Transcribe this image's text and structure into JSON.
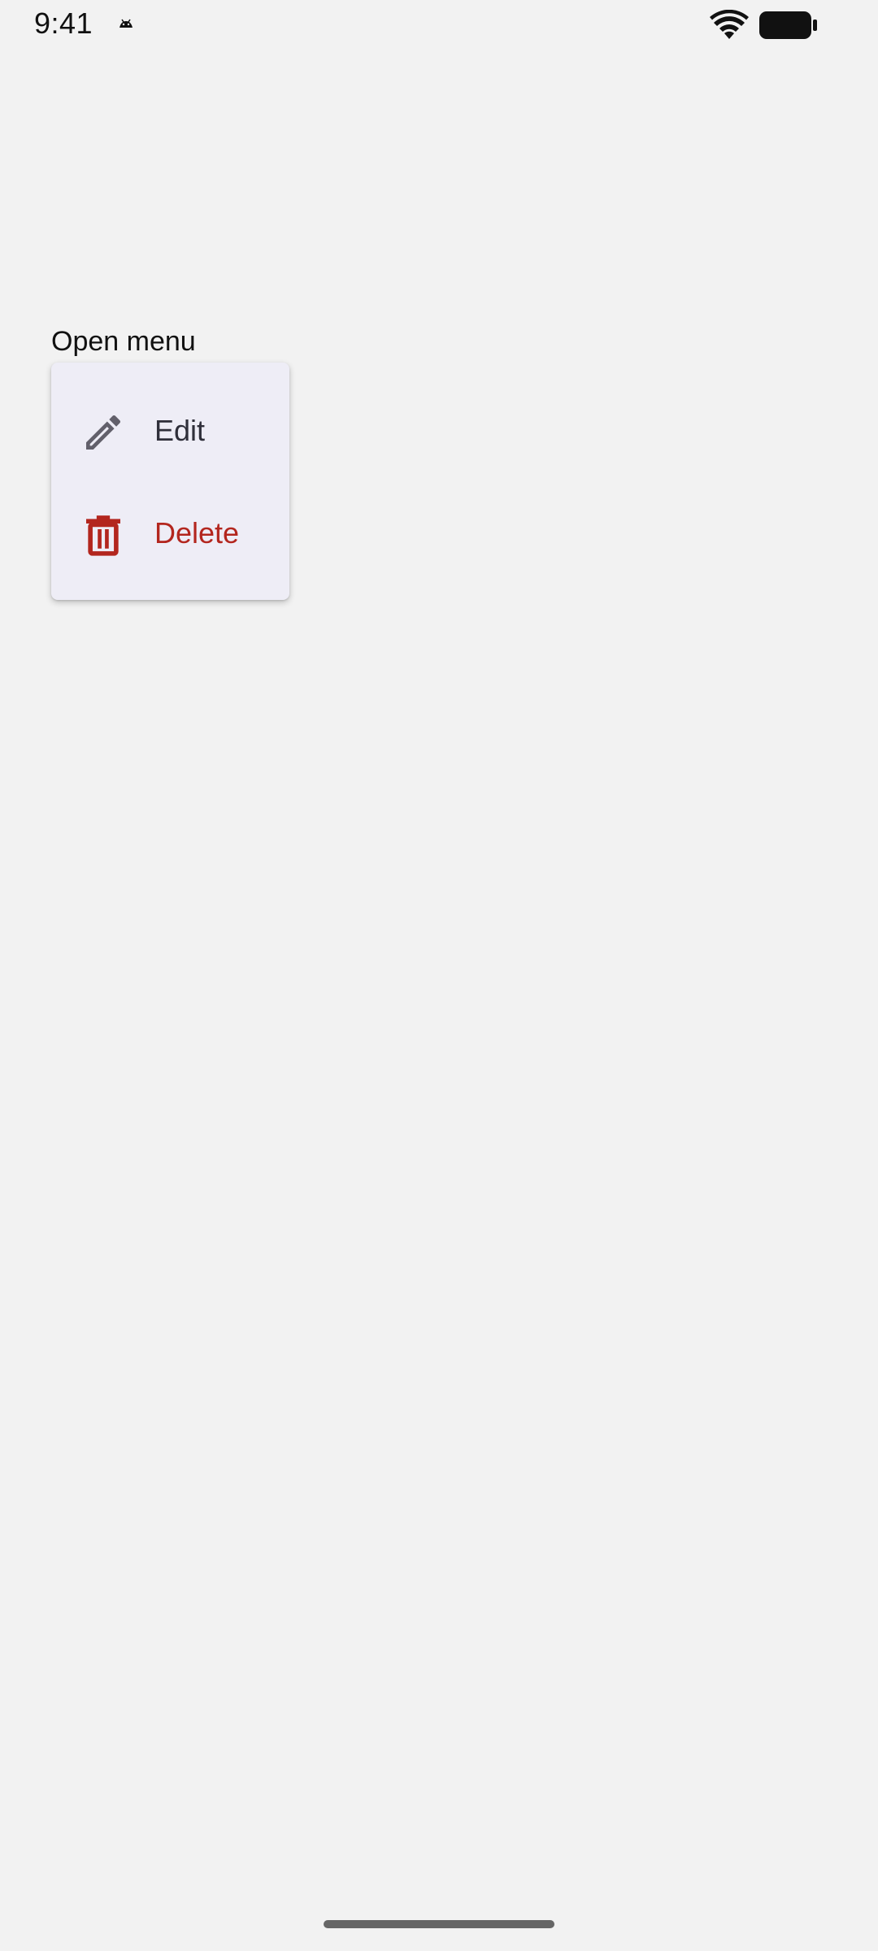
{
  "status_bar": {
    "time": "9:41"
  },
  "trigger": {
    "label": "Open menu"
  },
  "menu": {
    "items": [
      {
        "label": "Edit",
        "icon": "pencil-icon",
        "color": "#2f2f3a",
        "icon_color": "#62606b"
      },
      {
        "label": "Delete",
        "icon": "trash-icon",
        "color": "#b3261e",
        "icon_color": "#b3261e"
      }
    ]
  },
  "colors": {
    "background": "#f2f2f2",
    "menu_surface": "#eeedf6",
    "danger": "#b3261e"
  }
}
